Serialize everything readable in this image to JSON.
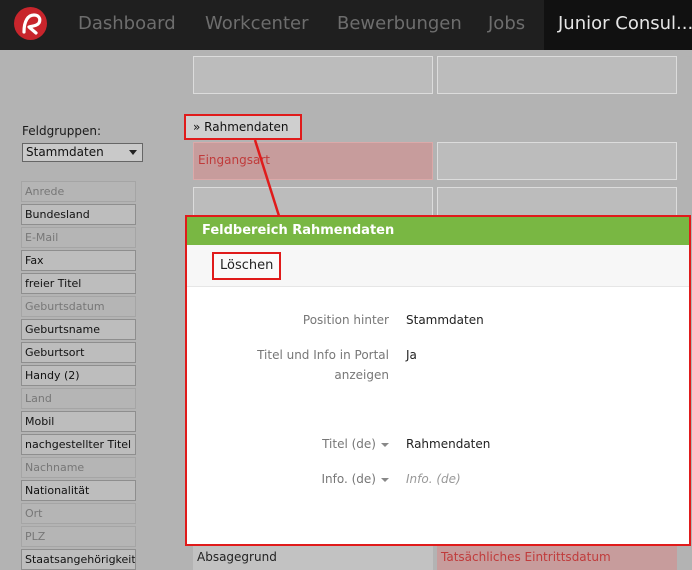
{
  "nav": {
    "tabs": [
      {
        "label": "Dashboard"
      },
      {
        "label": "Workcenter"
      },
      {
        "label": "Bewerbungen"
      },
      {
        "label": "Jobs"
      },
      {
        "label": "Junior Consul..."
      }
    ],
    "logo_icon": "brand-logo-icon"
  },
  "sidebar": {
    "field_groups_label": "Feldgruppen:",
    "field_groups_selected": "Stammdaten",
    "fields": [
      {
        "label": "Anrede",
        "muted": true
      },
      {
        "label": "Bundesland",
        "muted": false
      },
      {
        "label": "E-Mail",
        "muted": true
      },
      {
        "label": "Fax",
        "muted": false
      },
      {
        "label": "freier Titel",
        "muted": false
      },
      {
        "label": "Geburtsdatum",
        "muted": true
      },
      {
        "label": "Geburtsname",
        "muted": false
      },
      {
        "label": "Geburtsort",
        "muted": false
      },
      {
        "label": "Handy (2)",
        "muted": false
      },
      {
        "label": "Land",
        "muted": true
      },
      {
        "label": "Mobil",
        "muted": false
      },
      {
        "label": "nachgestellter Titel",
        "muted": false
      },
      {
        "label": "Nachname",
        "muted": true
      },
      {
        "label": "Nationalität",
        "muted": false
      },
      {
        "label": "Ort",
        "muted": true
      },
      {
        "label": "PLZ",
        "muted": true
      },
      {
        "label": "Staatsangehörigkeit",
        "muted": false
      }
    ]
  },
  "canvas": {
    "section_tag": "» Rahmendaten",
    "eingang_label": "Eingangsart",
    "bottom_left_label": "Absagegrund",
    "bottom_right_label": "Tatsächliches Eintrittsdatum"
  },
  "modal": {
    "title": "Feldbereich Rahmendaten",
    "delete_label": "Löschen",
    "rows": {
      "position_label": "Position hinter",
      "position_value": "Stammdaten",
      "portal_label": "Titel und Info in Portal anzeigen",
      "portal_value": "Ja",
      "title_label": "Titel (de)",
      "title_value": "Rahmendaten",
      "info_label": "Info. (de)",
      "info_placeholder": "Info. (de)"
    }
  },
  "colors": {
    "accent_green": "#79b743",
    "highlight_red": "#e01b1b",
    "brand_red": "#c8252c"
  }
}
